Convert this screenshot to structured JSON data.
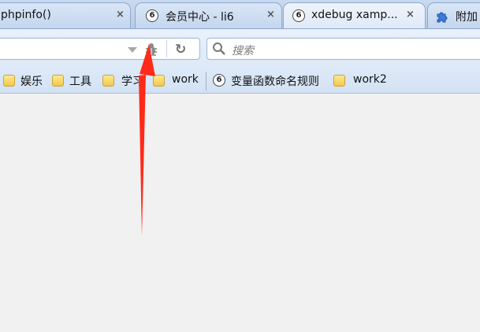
{
  "tabs": [
    {
      "title": "phpinfo()",
      "close": "×",
      "selected": false
    },
    {
      "title": "会员中心 - li6",
      "close": "×",
      "selected": false,
      "favicon": "6"
    },
    {
      "title": "xdebug xamp...",
      "close": "×",
      "selected": true,
      "favicon": "6"
    },
    {
      "title": "附加",
      "icon": "puzzle-icon",
      "selected": false
    }
  ],
  "navbar": {
    "url_value": "",
    "reload_glyph": "↻",
    "search_placeholder": "搜索"
  },
  "bookmarks": [
    {
      "label": "娱乐",
      "icon": "folder-icon"
    },
    {
      "label": "工具",
      "icon": "folder-icon"
    },
    {
      "label": "学习",
      "icon": "folder-icon"
    },
    {
      "label": "work",
      "icon": "folder-icon"
    },
    {
      "label": "变量函数命名规则",
      "icon": "site-icon",
      "favicon": "6"
    },
    {
      "label": "work2",
      "icon": "folder-icon"
    }
  ],
  "colors": {
    "annotation_arrow": "#ff2a1a",
    "chrome_blue": "#c9daf0"
  }
}
